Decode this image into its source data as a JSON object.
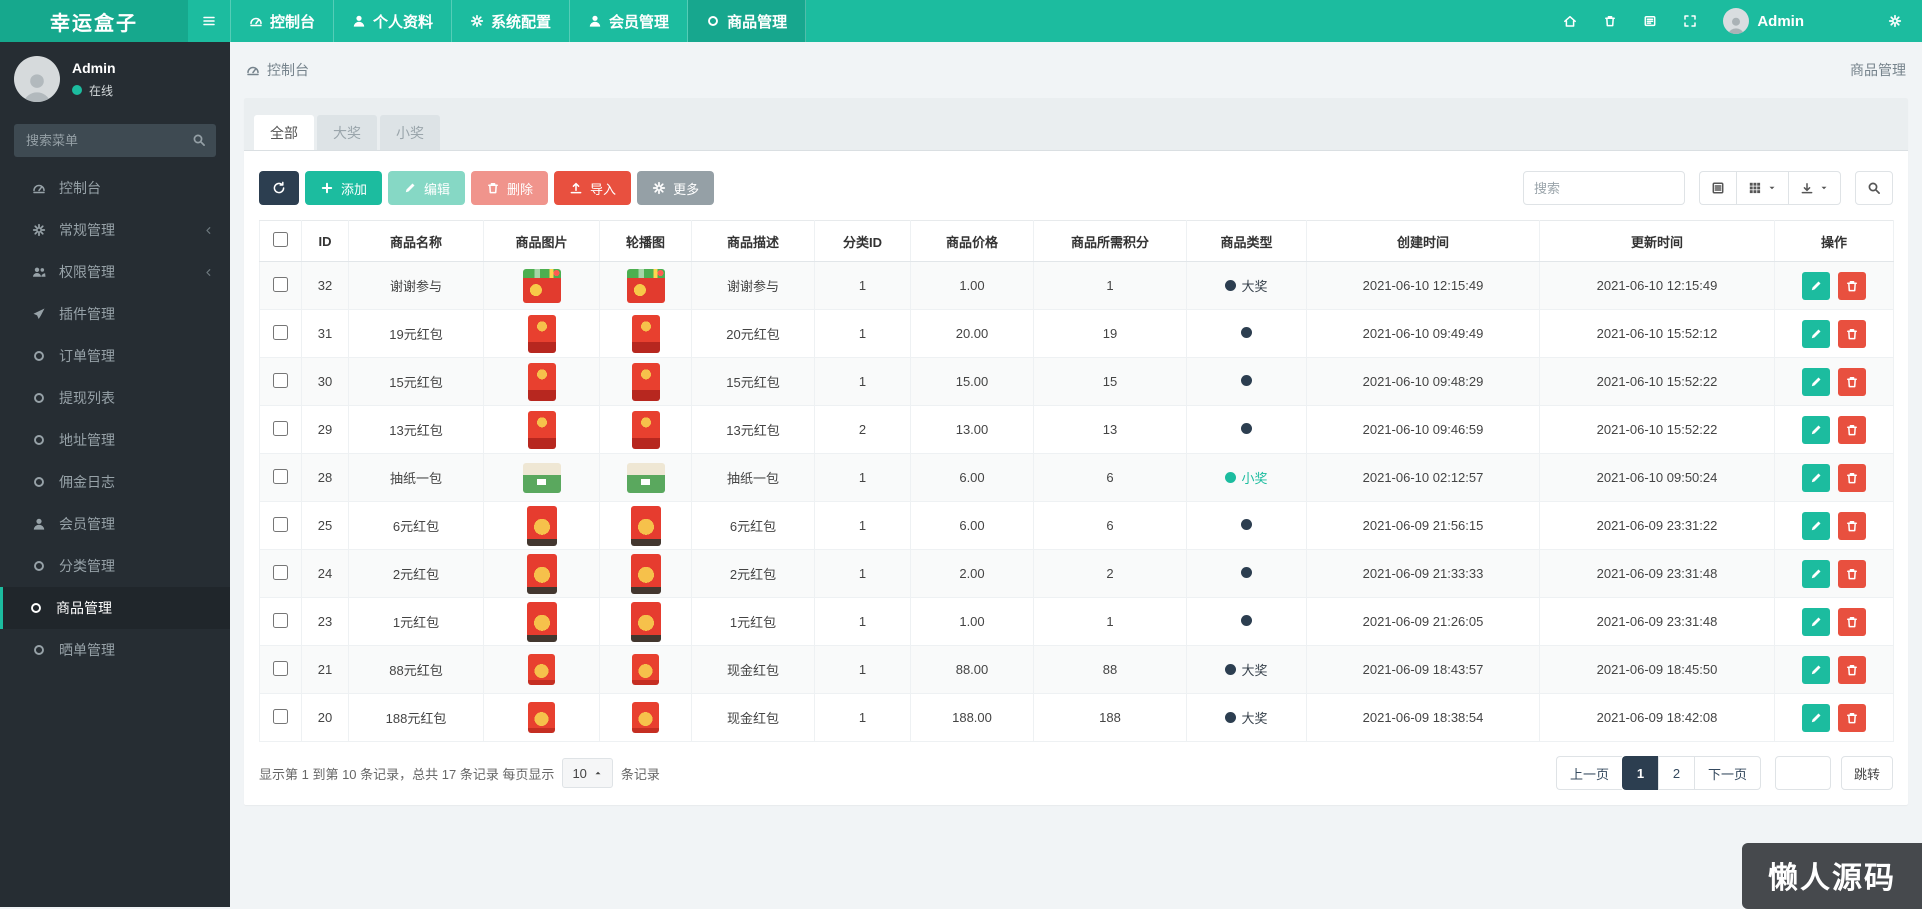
{
  "brand": "幸运盒子",
  "topnav": {
    "items": [
      {
        "label": "控制台",
        "icon": "gauge"
      },
      {
        "label": "个人资料",
        "icon": "user"
      },
      {
        "label": "系统配置",
        "icon": "gear"
      },
      {
        "label": "会员管理",
        "icon": "user"
      },
      {
        "label": "商品管理",
        "icon": "circle-o",
        "active": true
      }
    ],
    "right_icons": [
      {
        "name": "home"
      },
      {
        "name": "trash"
      },
      {
        "name": "language"
      },
      {
        "name": "expand"
      }
    ],
    "admin_name": "Admin"
  },
  "sidebar": {
    "user_name": "Admin",
    "user_status": "在线",
    "search_placeholder": "搜索菜单",
    "items": [
      {
        "label": "控制台",
        "icon": "gauge"
      },
      {
        "label": "常规管理",
        "icon": "gear",
        "chevron": true
      },
      {
        "label": "权限管理",
        "icon": "users",
        "chevron": true
      },
      {
        "label": "插件管理",
        "icon": "plane"
      },
      {
        "label": "订单管理",
        "icon": "circle-o"
      },
      {
        "label": "提现列表",
        "icon": "circle-o"
      },
      {
        "label": "地址管理",
        "icon": "circle-o"
      },
      {
        "label": "佣金日志",
        "icon": "circle-o"
      },
      {
        "label": "会员管理",
        "icon": "user"
      },
      {
        "label": "分类管理",
        "icon": "circle-o"
      },
      {
        "label": "商品管理",
        "icon": "circle-o",
        "active": true
      },
      {
        "label": "晒单管理",
        "icon": "circle-o"
      }
    ]
  },
  "breadcrumb": {
    "left": "控制台",
    "right": "商品管理"
  },
  "tabs": [
    {
      "label": "全部",
      "active": true
    },
    {
      "label": "大奖",
      "active": false
    },
    {
      "label": "小奖",
      "active": false
    }
  ],
  "toolbar": {
    "add": "添加",
    "edit": "编辑",
    "delete": "删除",
    "import": "导入",
    "more": "更多",
    "search_placeholder": "搜索"
  },
  "table": {
    "headers": [
      "ID",
      "商品名称",
      "商品图片",
      "轮播图",
      "商品描述",
      "分类ID",
      "商品价格",
      "商品所需积分",
      "商品类型",
      "创建时间",
      "更新时间",
      "操作"
    ],
    "rows": [
      {
        "id": "32",
        "name": "谢谢参与",
        "img": "red-gift-box",
        "desc": "谢谢参与",
        "category": "1",
        "price": "1.00",
        "points": "1",
        "type": "大奖",
        "type_color": "navy",
        "created": "2021-06-10 12:15:49",
        "updated": "2021-06-10 12:15:49"
      },
      {
        "id": "31",
        "name": "19元红包",
        "img": "red-envelope",
        "desc": "20元红包",
        "category": "1",
        "price": "20.00",
        "points": "19",
        "type": "",
        "type_color": "navy",
        "created": "2021-06-10 09:49:49",
        "updated": "2021-06-10 15:52:12"
      },
      {
        "id": "30",
        "name": "15元红包",
        "img": "red-envelope",
        "desc": "15元红包",
        "category": "1",
        "price": "15.00",
        "points": "15",
        "type": "",
        "type_color": "navy",
        "created": "2021-06-10 09:48:29",
        "updated": "2021-06-10 15:52:22"
      },
      {
        "id": "29",
        "name": "13元红包",
        "img": "red-envelope",
        "desc": "13元红包",
        "category": "2",
        "price": "13.00",
        "points": "13",
        "type": "",
        "type_color": "navy",
        "created": "2021-06-10 09:46:59",
        "updated": "2021-06-10 15:52:22"
      },
      {
        "id": "28",
        "name": "抽纸一包",
        "img": "tissue-pack",
        "desc": "抽纸一包",
        "category": "1",
        "price": "6.00",
        "points": "6",
        "type": "小奖",
        "type_color": "green",
        "created": "2021-06-10 02:12:57",
        "updated": "2021-06-10 09:50:24"
      },
      {
        "id": "25",
        "name": "6元红包",
        "img": "red-envelope-coin",
        "desc": "6元红包",
        "category": "1",
        "price": "6.00",
        "points": "6",
        "type": "",
        "type_color": "navy",
        "created": "2021-06-09 21:56:15",
        "updated": "2021-06-09 23:31:22"
      },
      {
        "id": "24",
        "name": "2元红包",
        "img": "red-envelope-coin",
        "desc": "2元红包",
        "category": "1",
        "price": "2.00",
        "points": "2",
        "type": "",
        "type_color": "navy",
        "created": "2021-06-09 21:33:33",
        "updated": "2021-06-09 23:31:48"
      },
      {
        "id": "23",
        "name": "1元红包",
        "img": "red-envelope-coin",
        "desc": "1元红包",
        "category": "1",
        "price": "1.00",
        "points": "1",
        "type": "",
        "type_color": "navy",
        "created": "2021-06-09 21:26:05",
        "updated": "2021-06-09 23:31:48"
      },
      {
        "id": "21",
        "name": "88元红包",
        "img": "red-packet-coin",
        "desc": "现金红包",
        "category": "1",
        "price": "88.00",
        "points": "88",
        "type": "大奖",
        "type_color": "navy",
        "created": "2021-06-09 18:43:57",
        "updated": "2021-06-09 18:45:50"
      },
      {
        "id": "20",
        "name": "188元红包",
        "img": "red-packet-coin",
        "desc": "现金红包",
        "category": "1",
        "price": "188.00",
        "points": "188",
        "type": "大奖",
        "type_color": "navy",
        "created": "2021-06-09 18:38:54",
        "updated": "2021-06-09 18:42:08"
      }
    ]
  },
  "pagination": {
    "info_prefix": "显示第 1 到第 10 条记录，总共 17 条记录 每页显示",
    "page_size": "10",
    "info_suffix": "条记录",
    "prev": "上一页",
    "next": "下一页",
    "pages": [
      "1",
      "2"
    ],
    "active_page": "1",
    "jump": "跳转"
  },
  "watermark": "懒人源码",
  "colors": {
    "navbar_green": "#1cbc9f",
    "brand_green": "#16a88d",
    "sidebar_dark": "#262d33",
    "accent_teal": "#1cbc9f",
    "navy": "#2c3e50",
    "danger_red": "#e8503f",
    "disabled_red": "#f0948c",
    "disabled_teal": "#86d8c5",
    "gray_button": "#95a0a6",
    "online_dot": "#1cbc9f"
  }
}
